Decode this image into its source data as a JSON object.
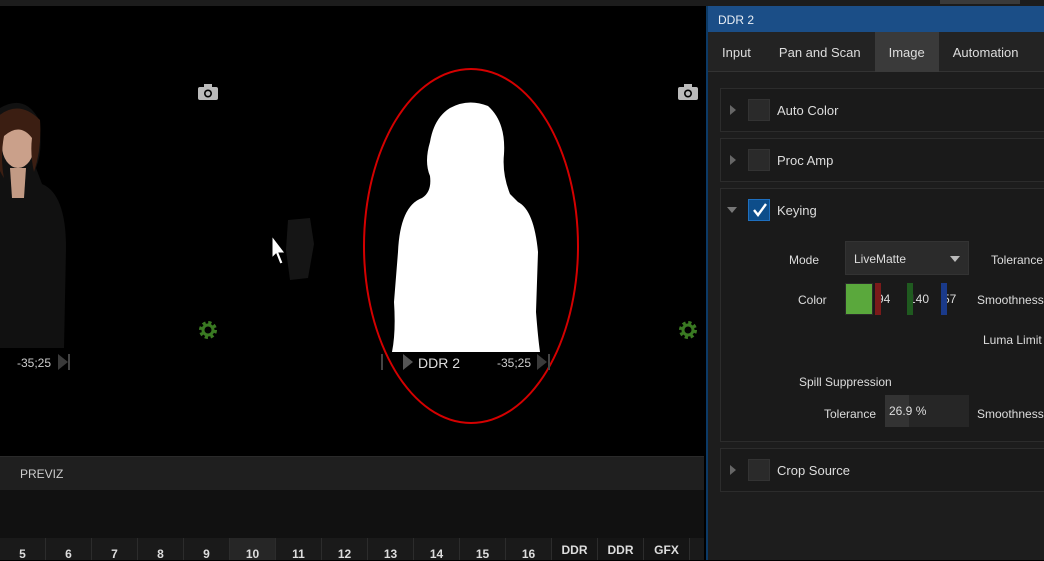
{
  "preview": {
    "ddr_label": "DDR 2",
    "timecode_left": "-35;25",
    "timecode_right": "-35;25"
  },
  "previz": {
    "label": "PREVIZ"
  },
  "switcher_keys": [
    "5",
    "6",
    "7",
    "8",
    "9",
    "10",
    "11",
    "12",
    "13",
    "14",
    "15",
    "16",
    "DDR",
    "DDR",
    "GFX"
  ],
  "panel": {
    "title": "DDR 2",
    "tabs": [
      "Input",
      "Pan and Scan",
      "Image",
      "Automation"
    ],
    "active_tab": "Image",
    "sections": {
      "auto_color": "Auto Color",
      "proc_amp": "Proc Amp",
      "keying": "Keying",
      "crop_source": "Crop Source"
    },
    "keying": {
      "mode_label": "Mode",
      "mode_value": "LiveMatte",
      "tolerance_label": "Tolerance",
      "color_label": "Color",
      "color_hex": "#5aa83c",
      "red": "94",
      "green": "140",
      "blue": "57",
      "smoothness_label": "Smoothness",
      "luma_limit_label": "Luma Limit",
      "spill_label": "Spill Suppression",
      "spill_tolerance_label": "Tolerance",
      "spill_tolerance_value": "26.9 %",
      "spill_smoothness_label": "Smoothness"
    }
  },
  "colors": {
    "highlight_ring": "#d40000",
    "title_bar": "#1b4e87",
    "gear": "#3a7a22"
  }
}
